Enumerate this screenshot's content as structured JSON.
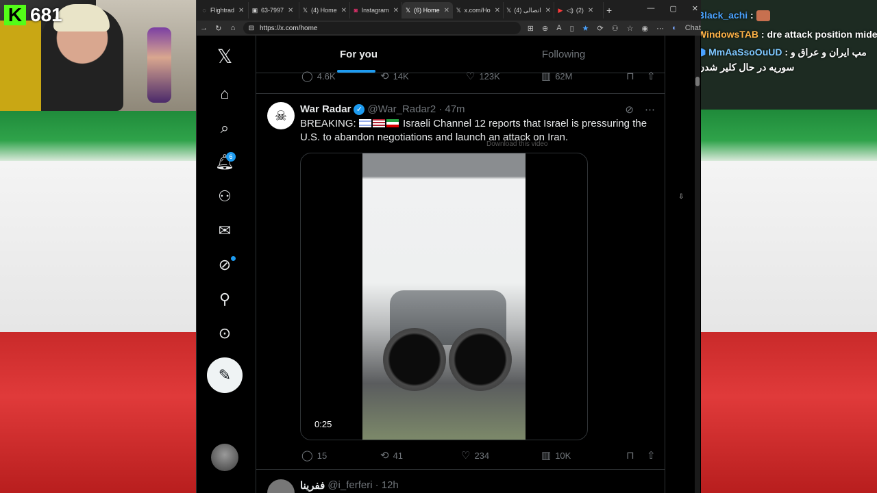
{
  "stream": {
    "kick_count": "681"
  },
  "chat": [
    {
      "user": "Black_achi",
      "sep": " :",
      "message": ""
    },
    {
      "user": "WindowsTAB",
      "sep": " :",
      "message": "dre attack position mide"
    },
    {
      "user": "MmAaSsoOuUD",
      "sep": " :",
      "message": "مپ ایران و عراق و"
    },
    {
      "user": "",
      "sep": "",
      "message": "سوریه در حال کلیر شدن"
    }
  ],
  "browser": {
    "tabs": [
      {
        "label": "Flightrad",
        "icon": "globe-icon",
        "active": false
      },
      {
        "label": "63-7997",
        "icon": "page-icon",
        "active": false
      },
      {
        "label": "(4) Home",
        "icon": "x-logo-icon",
        "active": false
      },
      {
        "label": "Instagram",
        "icon": "instagram-icon",
        "active": false
      },
      {
        "label": "(6) Home",
        "icon": "x-logo-icon",
        "active": true
      },
      {
        "label": "x.com/Ho",
        "icon": "x-logo-icon",
        "active": false
      },
      {
        "label": "(4) اتصالی",
        "icon": "x-logo-icon",
        "active": false
      },
      {
        "label": "(2)",
        "icon": "youtube-icon",
        "active": false
      }
    ],
    "url": "https://x.com/home",
    "copilot_label": "Chat"
  },
  "twitter": {
    "nav": {
      "notifications_badge": "6"
    },
    "tabs": {
      "for_you": "For you",
      "following": "Following"
    },
    "prev_tweet_actions": {
      "replies": "4.6K",
      "reposts": "14K",
      "likes": "123K",
      "views": "62M"
    },
    "tweet": {
      "name": "War Radar",
      "handle": "@War_Radar2",
      "time": "· 47m",
      "text_prefix": "BREAKING:",
      "text_body": "Israeli Channel 12 reports that Israel is pressuring the U.S. to abandon negotiations and launch an attack on Iran.",
      "video_duration": "0:25",
      "download_hint": "Download this video",
      "actions": {
        "replies": "15",
        "reposts": "41",
        "likes": "234",
        "views": "10K"
      }
    },
    "next_tweet": {
      "name": "ففرینا",
      "handle": "@i_ferferi",
      "time": "· 12h"
    }
  }
}
